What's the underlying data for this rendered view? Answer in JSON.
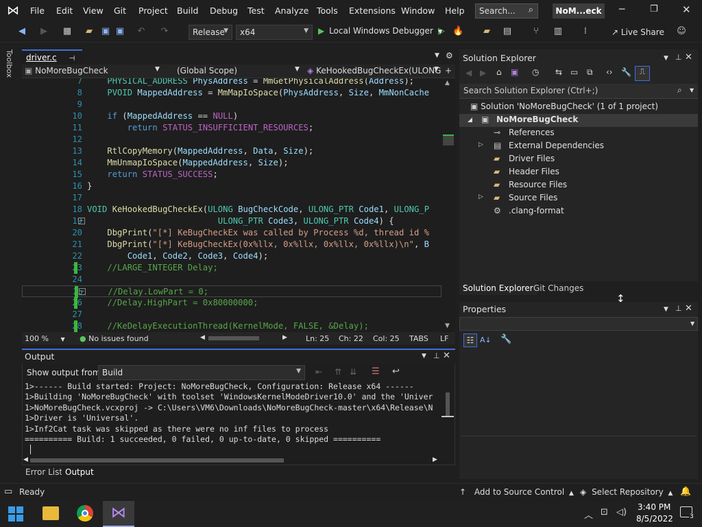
{
  "menu": {
    "items": [
      "File",
      "Edit",
      "View",
      "Git",
      "Project",
      "Build",
      "Debug",
      "Test",
      "Analyze",
      "Tools",
      "Extensions",
      "Window",
      "Help"
    ],
    "search_label": "Search...",
    "title": "NoM...eck"
  },
  "toolbar": {
    "config": "Release",
    "platform": "x64",
    "debugger": "Local Windows Debugger",
    "live_share": "Live Share"
  },
  "toolbox": {
    "label": "Toolbox"
  },
  "editor": {
    "tab": "driver.c",
    "nav_project": "NoMoreBugCheck",
    "nav_scope": "(Global Scope)",
    "nav_function": "KeHookedBugCheckEx(ULONG",
    "lines": [
      {
        "n": "7",
        "html": "    <span class='ty'>PHYSICAL_ADDRESS</span> <span class='va'>PhysAddress</span> = <span class='fn'>MmGetPhysicalAddress</span>(<span class='va'>Address</span>);"
      },
      {
        "n": "8",
        "html": "    <span class='ty'>PVOID</span> <span class='va'>MappedAddress</span> = <span class='fn'>MmMapIoSpace</span>(<span class='va'>PhysAddress</span>, <span class='va'>Size</span>, <span class='va'>MmNonCache</span>"
      },
      {
        "n": "9",
        "html": ""
      },
      {
        "n": "10",
        "html": "    <span class='kw'>if</span> (<span class='va'>MappedAddress</span> == <span class='mc'>NULL</span>)"
      },
      {
        "n": "11",
        "html": "        <span class='kw'>return</span> <span class='mc'>STATUS_INSUFFICIENT_RESOURCES</span>;"
      },
      {
        "n": "12",
        "html": ""
      },
      {
        "n": "13",
        "html": "    <span class='fn'>RtlCopyMemory</span>(<span class='va'>MappedAddress</span>, <span class='va'>Data</span>, <span class='va'>Size</span>);"
      },
      {
        "n": "14",
        "html": "    <span class='fn'>MmUnmapIoSpace</span>(<span class='va'>MappedAddress</span>, <span class='va'>Size</span>);"
      },
      {
        "n": "15",
        "html": "    <span class='kw'>return</span> <span class='mc'>STATUS_SUCCESS</span>;"
      },
      {
        "n": "16",
        "html": "}"
      },
      {
        "n": "17",
        "html": ""
      },
      {
        "n": "18",
        "html": "<span class='ty'>VOID</span> <span class='fn'>KeHookedBugCheckEx</span>(<span class='ty'>ULONG</span> <span class='va'>BugCheckCode</span>, <span class='ty'>ULONG_PTR</span> <span class='va'>Code1</span>, <span class='ty'>ULONG_P</span>"
      },
      {
        "n": "19",
        "html": "                          <span class='ty'>ULONG_PTR</span> <span class='va'>Code3</span>, <span class='ty'>ULONG_PTR</span> <span class='va'>Code4</span>) {"
      },
      {
        "n": "20",
        "html": "    <span class='fn'>DbgPrint</span>(<span class='st'>\"[*] KeBugCheckEx was called by Process %d, thread id %</span>"
      },
      {
        "n": "21",
        "html": "    <span class='fn'>DbgPrint</span>(<span class='st'>\"[*] KeBugCheckEx(0x%llx, 0x%llx, 0x%llx, 0x%llx)\\n\"</span>, <span class='va'>B</span>"
      },
      {
        "n": "22",
        "html": "        <span class='va'>Code1</span>, <span class='va'>Code2</span>, <span class='va'>Code3</span>, <span class='va'>Code4</span>);"
      },
      {
        "n": "23",
        "html": "    <span class='cm'>//LARGE_INTEGER Delay;</span>"
      },
      {
        "n": "24",
        "html": ""
      },
      {
        "n": "25",
        "html": "    <span class='cm'>//Delay.LowPart = 0;</span>"
      },
      {
        "n": "26",
        "html": "    <span class='cm'>//Delay.HighPart = 0x80000000;</span>"
      },
      {
        "n": "27",
        "html": ""
      },
      {
        "n": "28",
        "html": "    <span class='cm'>//KeDelayExecutionThread(KernelMode, FALSE, &amp;Delay);</span>"
      }
    ],
    "status": {
      "zoom": "100 %",
      "issues": "No issues found",
      "ln": "Ln: 25",
      "ch": "Ch: 22",
      "col": "Col: 25",
      "tabs": "TABS",
      "eol": "LF"
    }
  },
  "output": {
    "title": "Output",
    "show_from_label": "Show output from:",
    "source": "Build",
    "lines": [
      "1>------ Build started: Project: NoMoreBugCheck, Configuration: Release x64 ------",
      "1>Building 'NoMoreBugCheck' with toolset 'WindowsKernelModeDriver10.0' and the 'Univer",
      "1>NoMoreBugCheck.vcxproj -> C:\\Users\\VM6\\Downloads\\NoMoreBugCheck-master\\x64\\Release\\N",
      "1>Driver is 'Universal'.",
      "1>Inf2Cat task was skipped as there were no inf files to process",
      "========== Build: 1 succeeded, 0 failed, 0 up-to-date, 0 skipped =========="
    ]
  },
  "bottom_tabs": [
    "Error List",
    "Output"
  ],
  "solution_explorer": {
    "title": "Solution Explorer",
    "search_placeholder": "Search Solution Explorer (Ctrl+;)",
    "solution": "Solution 'NoMoreBugCheck' (1 of 1 project)",
    "project": "NoMoreBugCheck",
    "items": [
      "References",
      "External Dependencies",
      "Driver Files",
      "Header Files",
      "Resource Files",
      "Source Files",
      ".clang-format"
    ],
    "tabs": [
      "Solution Explorer",
      "Git Changes"
    ]
  },
  "properties": {
    "title": "Properties"
  },
  "statusbar": {
    "ready": "Ready",
    "source_control": "Add to Source Control",
    "repository": "Select Repository"
  },
  "taskbar": {
    "time": "3:40 PM",
    "date": "8/5/2022",
    "notifications": "3"
  }
}
